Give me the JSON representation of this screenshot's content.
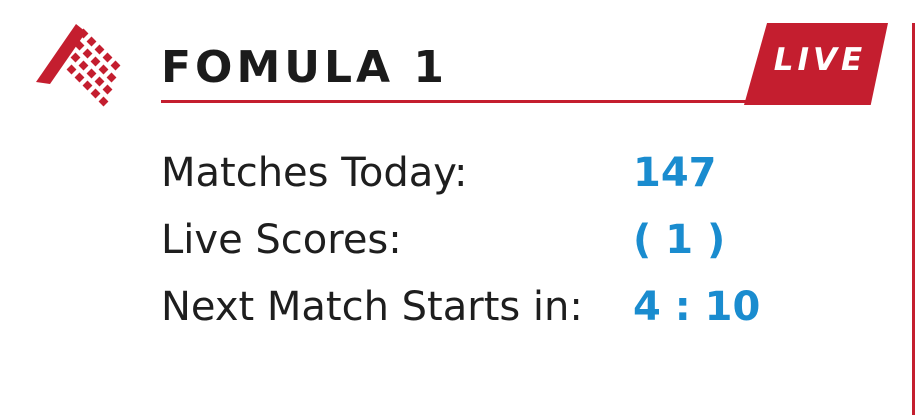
{
  "header": {
    "title": "FOMULA 1",
    "live_label": "LIVE"
  },
  "logo": {
    "icon": "checkered-flag-icon"
  },
  "stats": [
    {
      "label": "Matches Today:",
      "value": "147"
    },
    {
      "label": "Live Scores:",
      "value": "( 1 )"
    },
    {
      "label": "Next Match Starts in:",
      "value": "4 : 10"
    }
  ],
  "colors": {
    "accent_red": "#c41e2f",
    "value_blue": "#1a8ccf",
    "text_dark": "#1e1e1e"
  }
}
